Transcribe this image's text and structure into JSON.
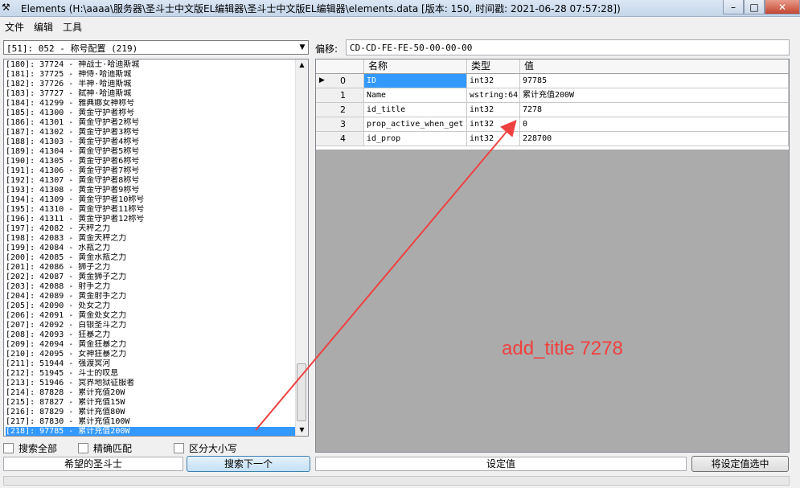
{
  "window": {
    "title": "Elements (H:\\aaaa\\服务器\\圣斗士中文版EL编辑器\\圣斗士中文版EL编辑器\\elements.data [版本: 150, 时间戳: 2021-06-28 07:57:28])",
    "minimize": "–",
    "maximize": "□",
    "close": "✕"
  },
  "menu": [
    "文件",
    "编辑",
    "工具"
  ],
  "category_dropdown": {
    "selected": "[51]: 052 - 称号配置 (219)"
  },
  "offset": {
    "label": "偏移:",
    "value": "CD-CD-FE-FE-50-00-00-00"
  },
  "item_list": [
    "[180]: 37724 - 神战士·哈迪斯城",
    "[181]: 37725 - 神侍·哈迪斯城",
    "[182]: 37726 - 半神·哈迪斯城",
    "[183]: 37727 - 弑神·哈迪斯城",
    "[184]: 41299 - 雅典娜女神称号",
    "[185]: 41300 - 黄金守护者称号",
    "[186]: 41301 - 黄金守护者2称号",
    "[187]: 41302 - 黄金守护者3称号",
    "[188]: 41303 - 黄金守护者4称号",
    "[189]: 41304 - 黄金守护者5称号",
    "[190]: 41305 - 黄金守护者6称号",
    "[191]: 41306 - 黄金守护者7称号",
    "[192]: 41307 - 黄金守护者8称号",
    "[193]: 41308 - 黄金守护者9称号",
    "[194]: 41309 - 黄金守护者10称号",
    "[195]: 41310 - 黄金守护者11称号",
    "[196]: 41311 - 黄金守护者12称号",
    "[197]: 42082 - 天秤之力",
    "[198]: 42083 - 黄金天秤之力",
    "[199]: 42084 - 水瓶之力",
    "[200]: 42085 - 黄金水瓶之力",
    "[201]: 42086 - 狮子之力",
    "[202]: 42087 - 黄金狮子之力",
    "[203]: 42088 - 射手之力",
    "[204]: 42089 - 黄金射手之力",
    "[205]: 42090 - 处女之力",
    "[206]: 42091 - 黄金处女之力",
    "[207]: 42092 - 白银圣斗之力",
    "[208]: 42093 - 狂暴之力",
    "[209]: 42094 - 黄金狂暴之力",
    "[210]: 42095 - 女神狂暴之力",
    "[211]: 51944 - 强渡冥河",
    "[212]: 51945 - 斗士的叹息",
    "[213]: 51946 - 冥界地狱征服者",
    "[214]: 87828 - 累计充值20W",
    "[215]: 87827 - 累计充值15W",
    "[216]: 87829 - 累计充值80W",
    "[217]: 87830 - 累计充值100W",
    "[218]: 97785 - 累计充值200W"
  ],
  "selected_item_index": 38,
  "grid": {
    "headers": {
      "name": "名称",
      "type": "类型",
      "value": "值"
    },
    "rows": [
      {
        "index": "0",
        "name": "ID",
        "type": "int32",
        "value": "97785",
        "current": true
      },
      {
        "index": "1",
        "name": "Name",
        "type": "wstring:64",
        "value": "累计充值200W"
      },
      {
        "index": "2",
        "name": "id_title",
        "type": "int32",
        "value": "7278"
      },
      {
        "index": "3",
        "name": "prop_active_when_get",
        "type": "int32",
        "value": "0"
      },
      {
        "index": "4",
        "name": "id_prop",
        "type": "int32",
        "value": "228700"
      }
    ]
  },
  "options": {
    "search_all": "搜索全部",
    "exact_match": "精确匹配",
    "case_sensitive": "区分大小写"
  },
  "search": {
    "value": "希望的圣斗士",
    "next_button": "搜索下一个"
  },
  "set_value": {
    "placeholder": "设定值",
    "apply_button": "将设定值选中"
  },
  "annotation": {
    "text": "add_title 7278",
    "color": "#f04040"
  },
  "colors": {
    "selection": "#3399ff",
    "annotation": "#f04040"
  }
}
